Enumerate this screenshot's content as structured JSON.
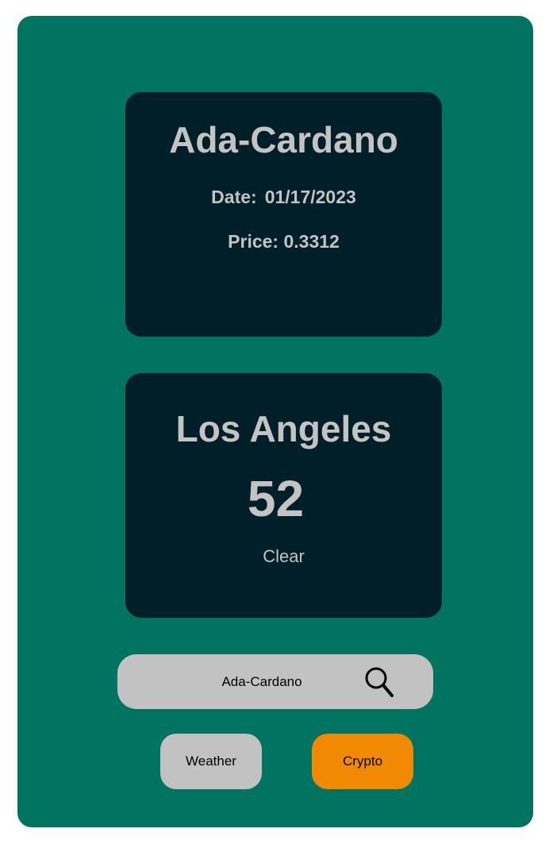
{
  "crypto": {
    "name": "Ada-Cardano",
    "date_label": "Date:",
    "date": "01/17/2023",
    "price_label": "Price:",
    "price": "0.3312"
  },
  "weather": {
    "city": "Los Angeles",
    "temperature": "52",
    "condition": "Clear"
  },
  "search": {
    "value": "Ada-Cardano",
    "icon": "search-icon"
  },
  "tabs": {
    "weather_label": "Weather",
    "crypto_label": "Crypto",
    "active": "Crypto"
  },
  "colors": {
    "app_background": "#007461",
    "card_background": "#001f29",
    "card_text": "#c3c3c3",
    "search_background": "#c2c2c2",
    "active_tab": "#f18a00",
    "inactive_tab": "#c2c2c2"
  }
}
